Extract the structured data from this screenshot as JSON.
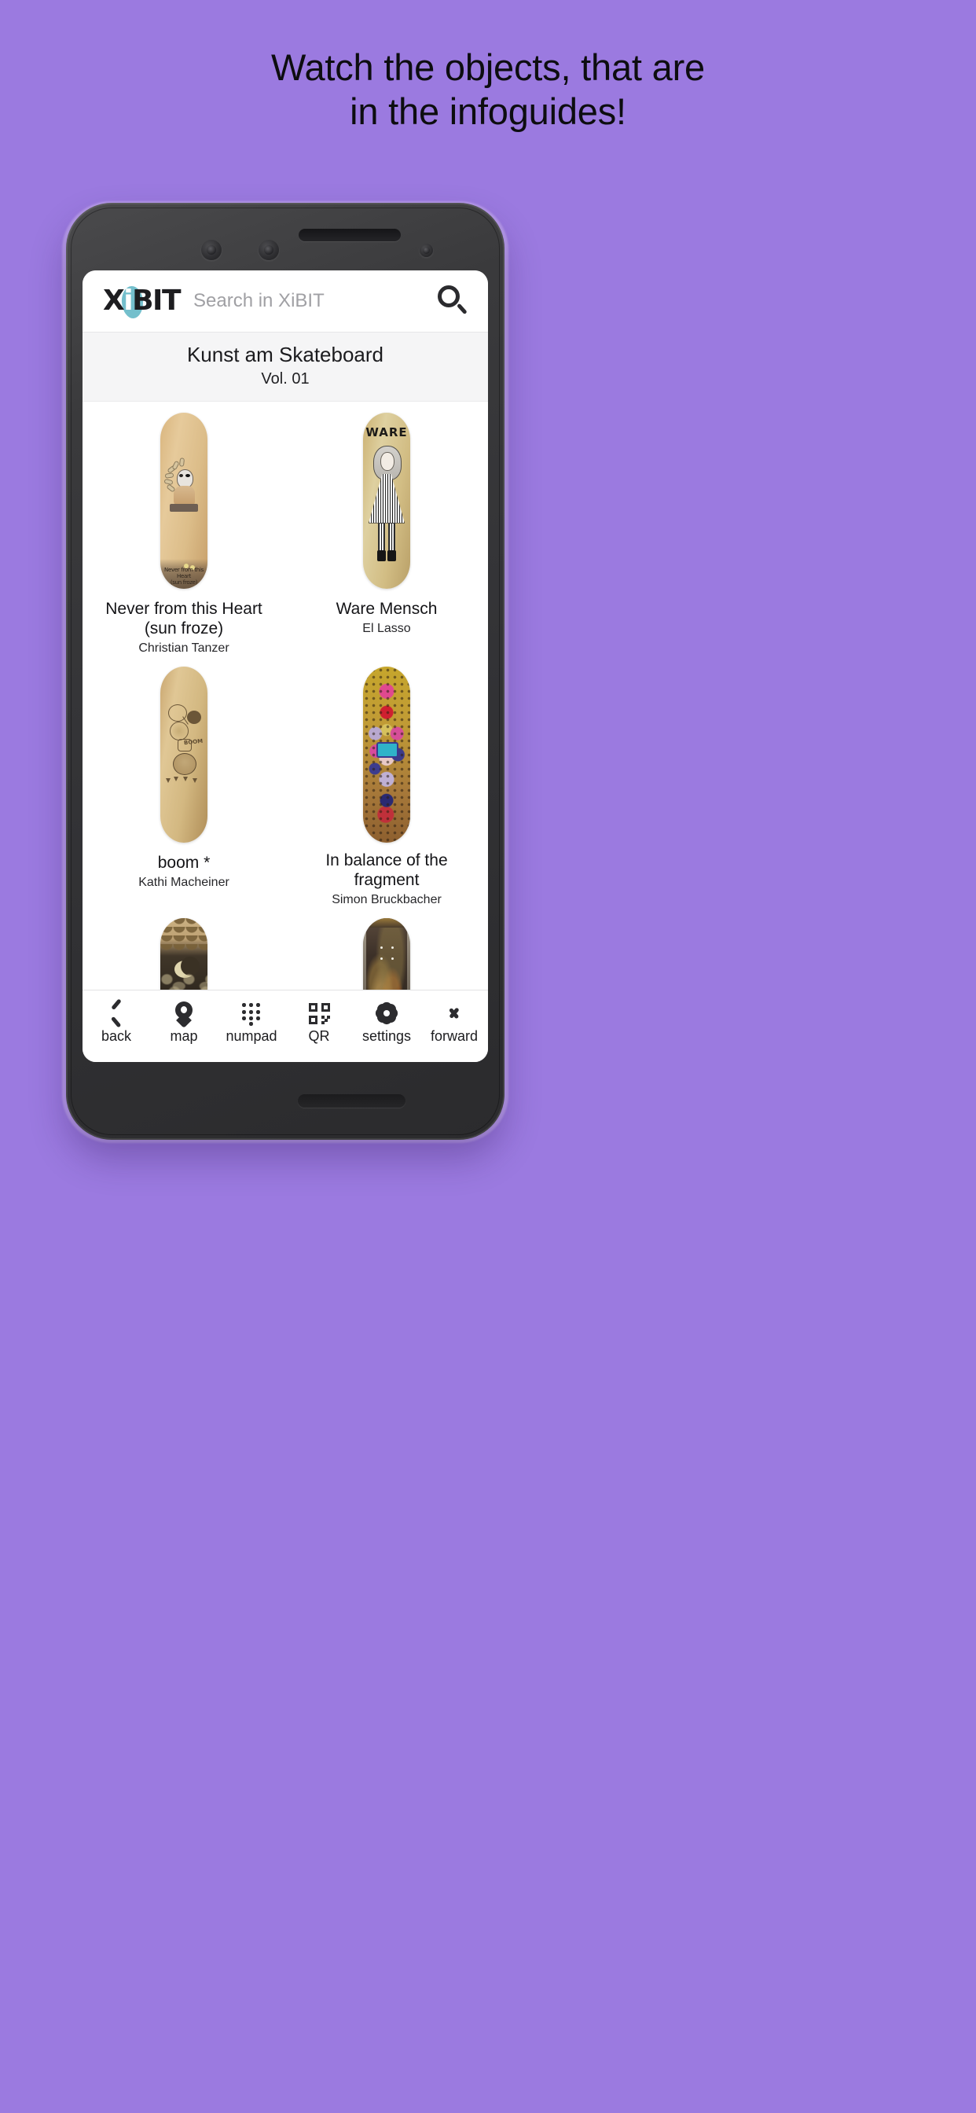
{
  "headline": {
    "line1": "Watch the objects, that are",
    "line2": "in the infoguides!"
  },
  "colors": {
    "background": "#9b7ae0",
    "logo_accent": "#74bfcc",
    "icon": "#2c2c2f",
    "title_band": "#f5f5f6"
  },
  "app": {
    "logo": {
      "part1": "X",
      "part2": "i",
      "part3": "BIT"
    },
    "search": {
      "placeholder": "Search in XiBIT",
      "value": ""
    },
    "search_icon": "search-icon",
    "exhibition": {
      "title": "Kunst am Skateboard",
      "volume": "Vol. 01"
    },
    "items": [
      {
        "title": "Never from this Heart",
        "title2": "(sun froze)",
        "artist": "Christian Tanzer"
      },
      {
        "title": "Ware Mensch",
        "title2": "",
        "artist": "El Lasso"
      },
      {
        "title": "boom *",
        "title2": "",
        "artist": "Kathi Macheiner"
      },
      {
        "title": "In balance of the fragment",
        "title2": "",
        "artist": "Simon Bruckbacher"
      },
      {
        "title": "",
        "title2": "",
        "artist": ""
      },
      {
        "title": "",
        "title2": "",
        "artist": ""
      }
    ],
    "deck_labels": {
      "deck1_text1": "Never from this Heart",
      "deck1_text2": "(sun froze)",
      "deck2_word": "WARE",
      "deck3_word": "BOOM"
    },
    "nav": [
      {
        "label": "back",
        "icon": "chevron-left-icon"
      },
      {
        "label": "map",
        "icon": "map-pin-icon"
      },
      {
        "label": "numpad",
        "icon": "numpad-icon"
      },
      {
        "label": "QR",
        "icon": "qr-code-icon"
      },
      {
        "label": "settings",
        "icon": "gear-icon"
      },
      {
        "label": "forward",
        "icon": "chevron-right-icon"
      }
    ]
  }
}
